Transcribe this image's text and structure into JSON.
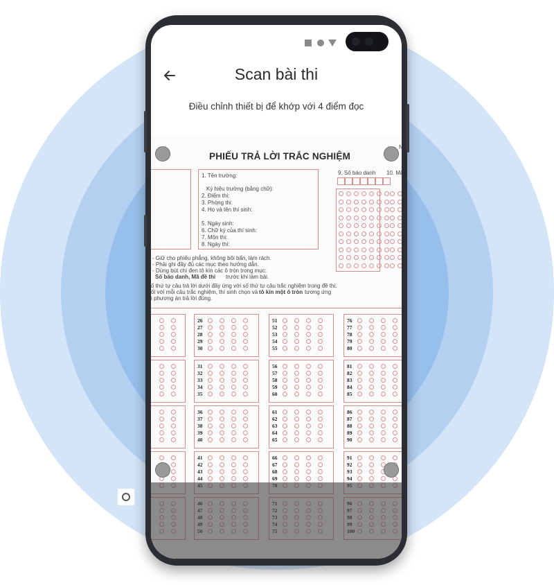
{
  "header": {
    "title": "Scan bài thi",
    "hint": "Điều chỉnh thiết bị để khớp với 4 điểm đọc",
    "back_icon": "arrow-left-icon"
  },
  "sheet": {
    "title": "PHIẾU TRẢ LỜI TRẮC NGHIỆM",
    "fields": [
      "1. Tên trường:",
      "Ký hiệu trường (bằng chữ):",
      "2. Điểm thi:",
      "3. Phòng thi:",
      "4. Họ và tên thí sinh:",
      "5. Ngày sinh:",
      "6. Chữ ký của thí sinh:",
      "7. Môn thi:",
      "8. Ngày thi:"
    ],
    "col9": "9. Số báo danh",
    "col10": "10. Mã",
    "col_edge": "N",
    "instructions": [
      "- Giữ cho phiếu phẳng, không bôi bẩn, làm rách.",
      "- Phải ghi đầy đủ các mục theo hướng dẫn.",
      "- Dùng bút chì đen tô kín các ô tròn trong mục:",
      "Số báo danh, Mã đề thi",
      " trước khi làm bài.",
      "ố thứ tự câu trả lời dưới đây ứng với số thứ tự câu trắc nghiệm trong đề thi.",
      "ối với mỗi câu trắc nghiệm, thí sinh chọn và ",
      "tô kín một ô tròn",
      " tương ứng",
      "i phương án trả lời đúng."
    ]
  },
  "answer_columns": [
    [
      "26",
      "27",
      "28",
      "29",
      "30",
      "31",
      "32",
      "33",
      "34",
      "35",
      "36",
      "37",
      "38",
      "39",
      "40",
      "41",
      "42",
      "43",
      "44",
      "45",
      "46",
      "47",
      "48",
      "49",
      "50"
    ],
    [
      "51",
      "52",
      "53",
      "54",
      "55",
      "56",
      "57",
      "58",
      "59",
      "60",
      "61",
      "62",
      "63",
      "64",
      "65",
      "66",
      "67",
      "68",
      "69",
      "70",
      "71",
      "72",
      "73",
      "74",
      "75"
    ],
    [
      "76",
      "77",
      "78",
      "79",
      "80",
      "81",
      "82",
      "83",
      "84",
      "85",
      "86",
      "87",
      "88",
      "89",
      "90",
      "91",
      "92",
      "93",
      "94",
      "95",
      "96",
      "97",
      "98",
      "99",
      "100"
    ]
  ],
  "controls": {
    "capture_icon": "camera-icon",
    "corner_markers": [
      "top-left",
      "top-right",
      "bottom-left",
      "bottom-right"
    ]
  }
}
